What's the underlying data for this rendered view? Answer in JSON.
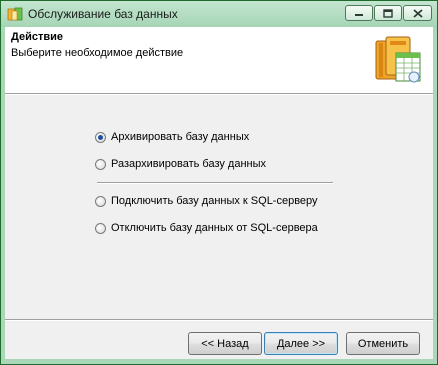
{
  "window": {
    "title": "Обслуживание баз данных",
    "min_icon": "minimize-icon",
    "max_icon": "maximize-icon",
    "close_icon": "close-icon"
  },
  "header": {
    "title": "Действие",
    "subtitle": "Выберите необходимое действие",
    "icon": "database-books-icon"
  },
  "options": [
    {
      "label": "Архивировать базу данных",
      "checked": true
    },
    {
      "label": "Разархивировать базу данных",
      "checked": false
    },
    {
      "label": "Подключить базу данных к SQL-серверу",
      "checked": false
    },
    {
      "label": "Отключить базу данных от SQL-сервера",
      "checked": false
    }
  ],
  "buttons": {
    "back": "<< Назад",
    "next": "Далее >>",
    "cancel": "Отменить"
  },
  "colors": {
    "frame": "#a9d7b8",
    "radio_dot": "#1c4fa0"
  }
}
